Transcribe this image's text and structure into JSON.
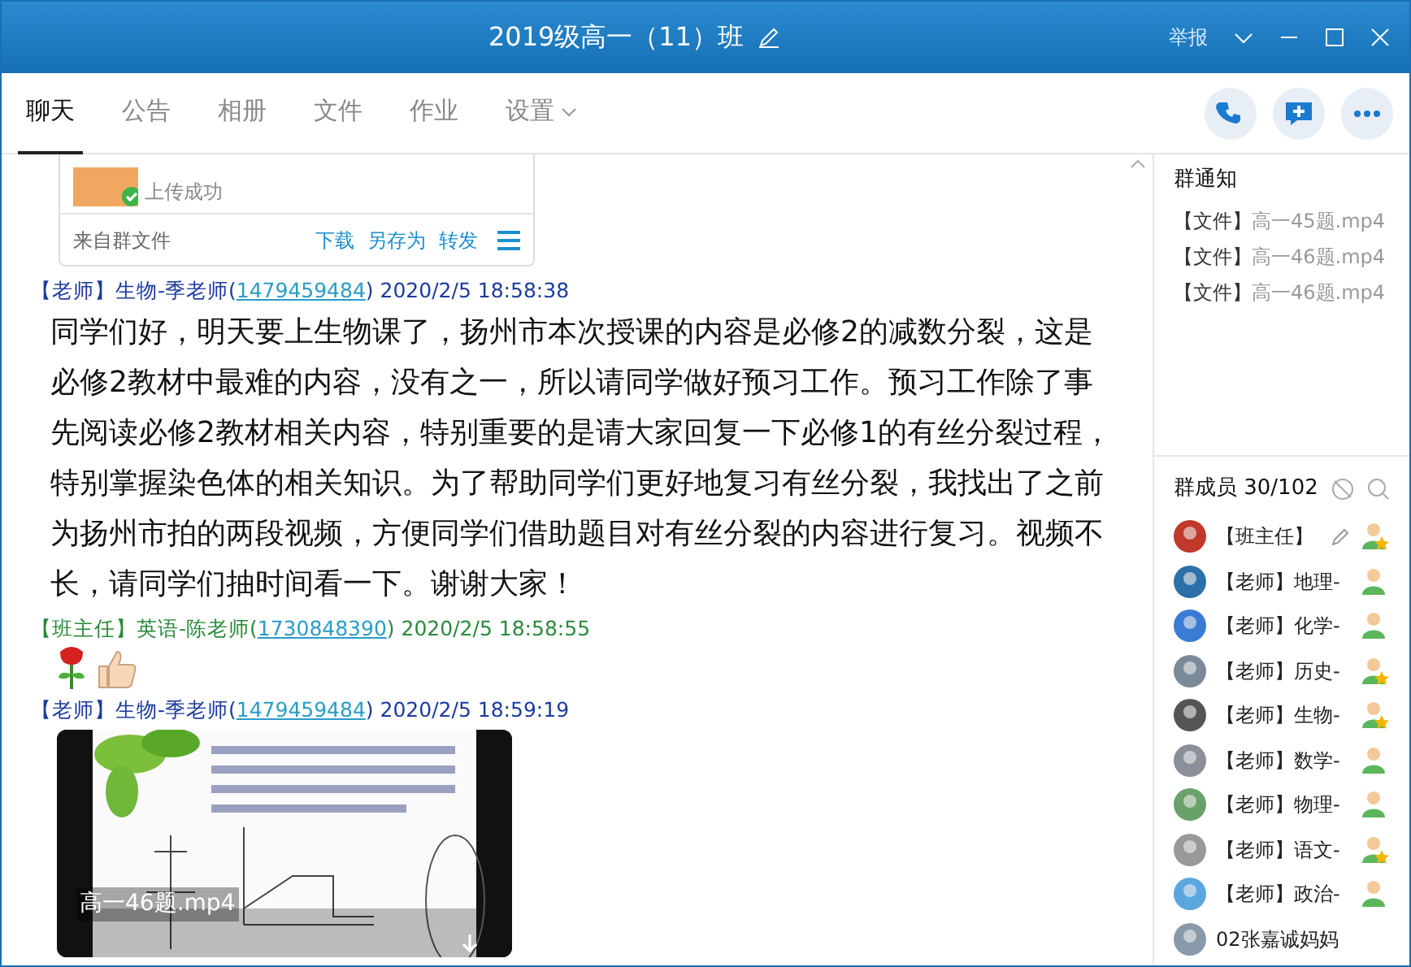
{
  "window": {
    "title": "2019级高一（11）班",
    "report": "举报"
  },
  "tabs": [
    {
      "label": "聊天",
      "selected": true
    },
    {
      "label": "公告",
      "selected": false
    },
    {
      "label": "相册",
      "selected": false
    },
    {
      "label": "文件",
      "selected": false
    },
    {
      "label": "作业",
      "selected": false
    },
    {
      "label": "设置",
      "selected": false,
      "dropdown": true
    }
  ],
  "messages": [
    {
      "kind": "file",
      "status": "上传成功",
      "source": "来自群文件",
      "actions": [
        "下载",
        "另存为",
        "转发"
      ]
    },
    {
      "kind": "text",
      "sender": {
        "role": "【老师】",
        "name": "生物-季老师(",
        "qq": "1479459484",
        "time": ") 2020/2/5 18:58:38",
        "color": "#1c3a9e"
      },
      "text": "同学们好，明天要上生物课了，扬州市本次授课的内容是必修2的减数分裂，这是必修2教材中最难的内容，没有之一，所以请同学做好预习工作。预习工作除了事先阅读必修2教材相关内容，特别重要的是请大家回复一下必修1的有丝分裂过程，特别掌握染色体的相关知识。为了帮助同学们更好地复习有丝分裂，我找出了之前为扬州市拍的两段视频，方便同学们借助题目对有丝分裂的内容进行复习。视频不长，请同学们抽时间看一下。谢谢大家！"
    },
    {
      "kind": "emoji",
      "sender": {
        "role": "【班主任】",
        "name": "英语-陈老师(",
        "qq": "1730848390",
        "time": ") 2020/2/5 18:58:55",
        "color": "#2a8a3a"
      },
      "emoji": [
        {
          "kind": "rose"
        },
        {
          "kind": "thumbs_up"
        }
      ]
    },
    {
      "kind": "video",
      "sender": {
        "role": "【老师】",
        "name": "生物-季老师(",
        "qq": "1479459484",
        "time": ") 2020/2/5 18:59:19",
        "color": "#1c3a9e"
      },
      "filename": "高一46题.mp4"
    }
  ],
  "notice": {
    "title": "群通知",
    "items": [
      {
        "tag": "【文件】",
        "name": "高一45题.mp4"
      },
      {
        "tag": "【文件】",
        "name": "高一46题.mp4"
      },
      {
        "tag": "【文件】",
        "name": "高一46题.mp4"
      }
    ]
  },
  "members": {
    "title": "群成员 30/102",
    "list": [
      {
        "name": "【班主任】",
        "admin": true,
        "editable": true
      },
      {
        "name": "【老师】地理-",
        "admin": false
      },
      {
        "name": "【老师】化学-",
        "admin": false
      },
      {
        "name": "【老师】历史-",
        "admin": true
      },
      {
        "name": "【老师】生物-",
        "admin": true
      },
      {
        "name": "【老师】数学-",
        "admin": false
      },
      {
        "name": "【老师】物理-",
        "admin": false
      },
      {
        "name": "【老师】语文-",
        "admin": true
      },
      {
        "name": "【老师】政治-",
        "admin": false
      },
      {
        "name": "02张嘉诚妈妈"
      }
    ]
  }
}
